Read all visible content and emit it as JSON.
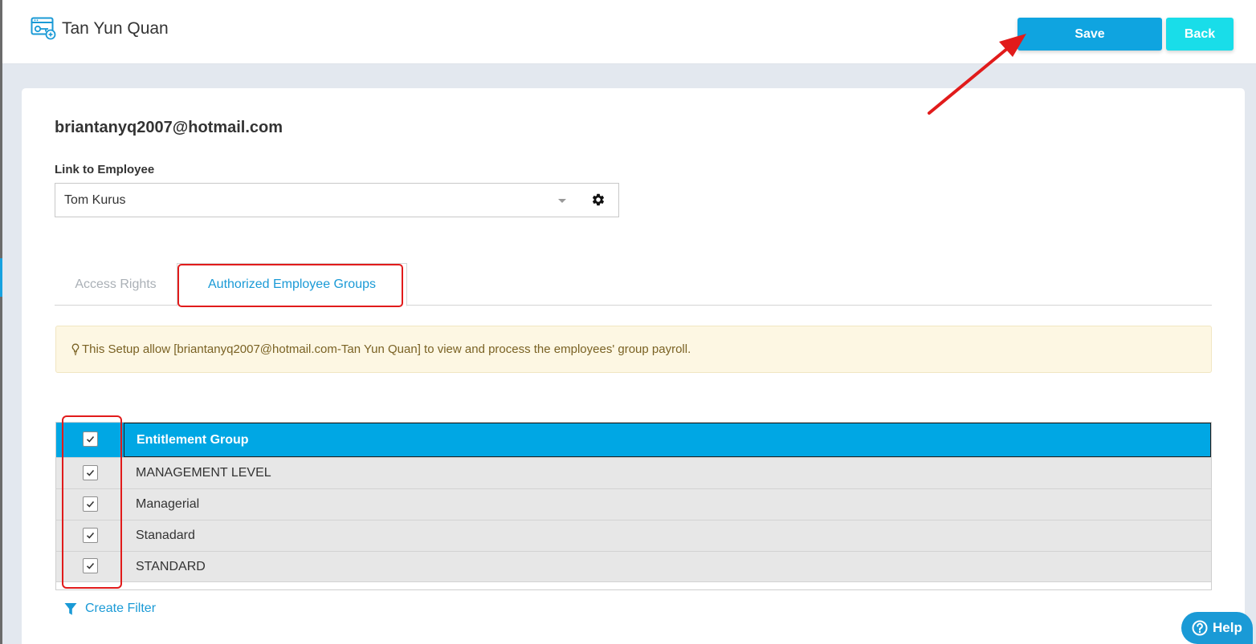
{
  "header": {
    "title": "Tan Yun Quan",
    "icon": "user-key-card-icon",
    "save_label": "Save",
    "back_label": "Back"
  },
  "form": {
    "email": "briantanyq2007@hotmail.com",
    "link_label": "Link to Employee",
    "employee_value": "Tom Kurus"
  },
  "tabs": [
    {
      "label": "Access Rights",
      "active": false
    },
    {
      "label": "Authorized Employee Groups",
      "active": true
    }
  ],
  "notice": {
    "text": "This Setup allow [briantanyq2007@hotmail.com-Tan Yun Quan] to view and process the employees' group payroll."
  },
  "grid": {
    "header": "Entitlement Group",
    "header_checked": true,
    "rows": [
      {
        "label": "MANAGEMENT LEVEL",
        "checked": true
      },
      {
        "label": "Managerial",
        "checked": true
      },
      {
        "label": "Stanadard",
        "checked": true
      },
      {
        "label": "STANDARD",
        "checked": true
      }
    ]
  },
  "filter": {
    "label": "Create Filter"
  },
  "help": {
    "label": "Help"
  },
  "colors": {
    "primary": "#0fa4e0",
    "back_button": "#19dde9",
    "grid_header": "#00a7e4",
    "annotation": "#e11b1b",
    "notice_bg": "#fdf7e3"
  }
}
